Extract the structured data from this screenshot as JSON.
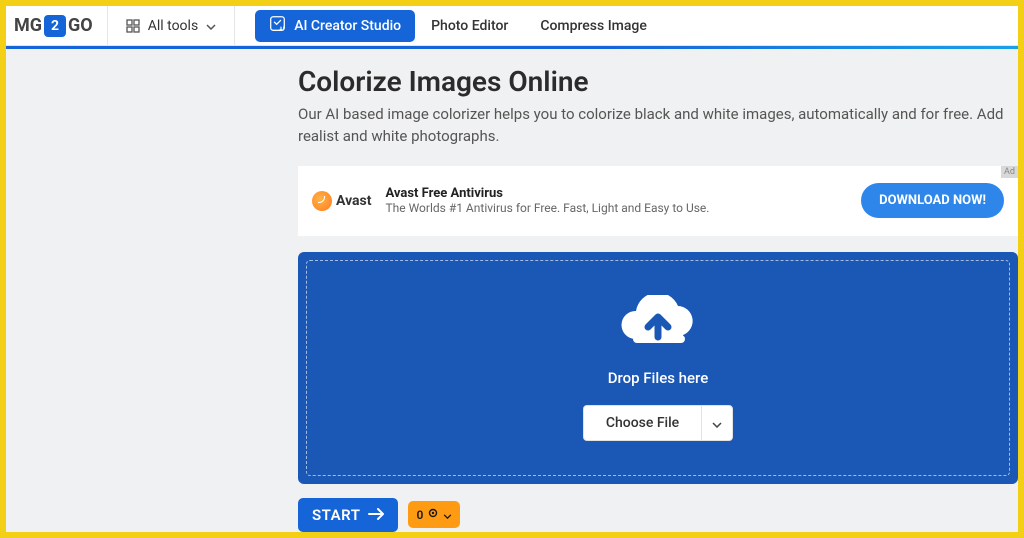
{
  "nav": {
    "logo_mg": "MG",
    "logo_num": "2",
    "logo_go": "GO",
    "all_tools": "All tools",
    "ai_studio": "AI Creator Studio",
    "photo_editor": "Photo Editor",
    "compress_image": "Compress Image"
  },
  "page": {
    "title": "Colorize Images Online",
    "lead": "Our AI based image colorizer helps you to colorize black and white images, automatically and for free. Add realist and white photographs."
  },
  "ad": {
    "tag": "Ad",
    "brand": "Avast",
    "title": "Avast Free Antivirus",
    "sub": "The Worlds #1 Antivirus for Free. Fast, Light and Easy to Use.",
    "cta": "DOWNLOAD NOW!"
  },
  "drop": {
    "label": "Drop Files here",
    "choose": "Choose File"
  },
  "actions": {
    "start": "START",
    "settings_count": "0"
  }
}
